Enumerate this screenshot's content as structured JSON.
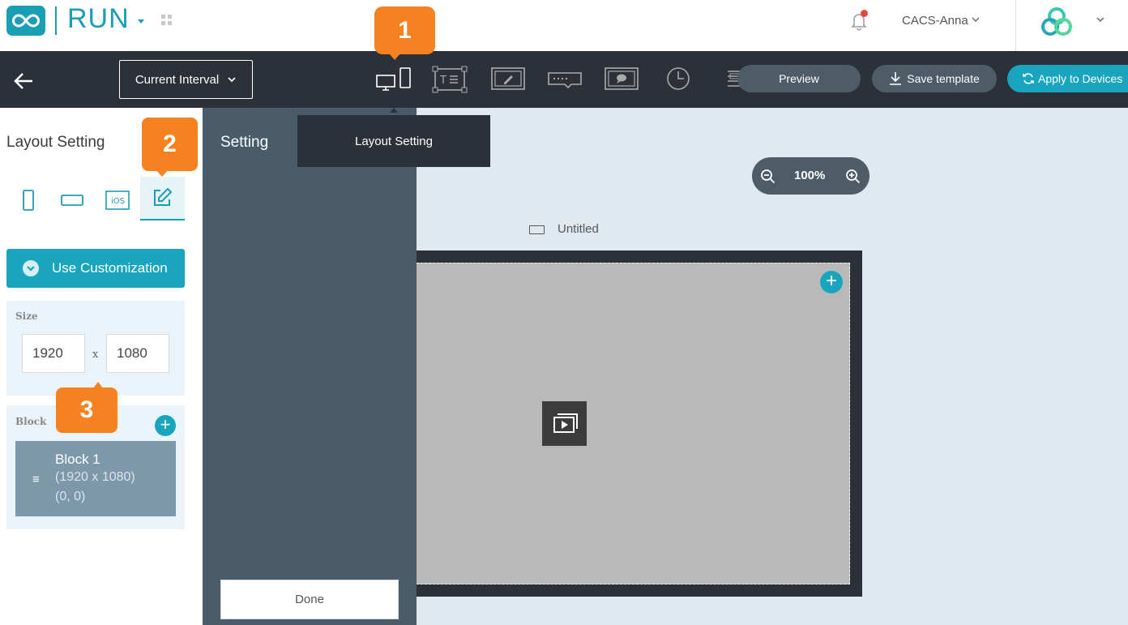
{
  "header": {
    "app_name": "RUN",
    "user_name": "CACS-Anna",
    "notification_badge_color": "#e14b3b",
    "brand_color": "#1a9eb3"
  },
  "toolbar": {
    "interval_select": "Current Interval",
    "tool_icons": [
      "layout-icon",
      "text-widget-icon",
      "draw-icon",
      "ticker-icon",
      "message-icon",
      "clock-icon",
      "align-icon"
    ],
    "preview_label": "Preview",
    "save_label": "Save template",
    "apply_label": "Apply to Devices"
  },
  "tooltip": {
    "text": "Layout Setting"
  },
  "left_panel": {
    "title": "Layout Setting",
    "orientation_options": [
      "portrait",
      "landscape",
      "ios",
      "custom"
    ],
    "use_customization_label": "Use Customization",
    "size_label": "Size",
    "width": "1920",
    "height": "1080",
    "size_separator": "x",
    "block_label": "Block",
    "blocks": [
      {
        "name": "Block 1",
        "size": "(1920 x 1080)",
        "position": "(0, 0)"
      }
    ]
  },
  "setting_panel": {
    "title": "Setting",
    "done_label": "Done"
  },
  "canvas": {
    "zoom": "100%",
    "template_name": "Untitled"
  },
  "callouts": [
    "1",
    "2",
    "3"
  ],
  "accent_color": "#f58220"
}
